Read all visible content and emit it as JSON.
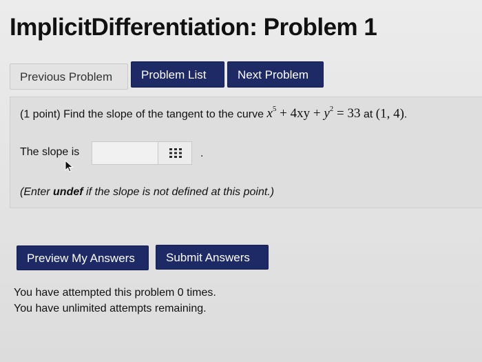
{
  "header": {
    "title": "ImplicitDifferentiation: Problem 1"
  },
  "nav": {
    "previous_label": "Previous Problem",
    "list_label": "Problem List",
    "next_label": "Next Problem"
  },
  "problem": {
    "points": "(1 point)",
    "text_before": "Find the slope of the tangent to the curve",
    "equation": {
      "term1_base": "x",
      "term1_exp": "5",
      "op1": " + ",
      "term2": "4xy",
      "op2": " + ",
      "term3_base": "y",
      "term3_exp": "2",
      "equals": " = 33"
    },
    "text_at": "at",
    "point": "(1, 4)",
    "end": "."
  },
  "answer": {
    "label": "The slope is",
    "value": "",
    "placeholder": "",
    "suffix": ".",
    "icon": "equation-editor-grid-icon"
  },
  "hint": {
    "prefix": "(Enter ",
    "keyword": "undef",
    "suffix": " if the slope is not defined at this point.)"
  },
  "actions": {
    "preview_label": "Preview My Answers",
    "submit_label": "Submit Answers"
  },
  "status": {
    "attempts_line": "You have attempted this problem 0 times.",
    "remaining_line": "You have unlimited attempts remaining."
  },
  "colors": {
    "primary_button": "#1d2a66",
    "secondary_button": "#e3e3e3",
    "problem_background": "#dedede"
  }
}
